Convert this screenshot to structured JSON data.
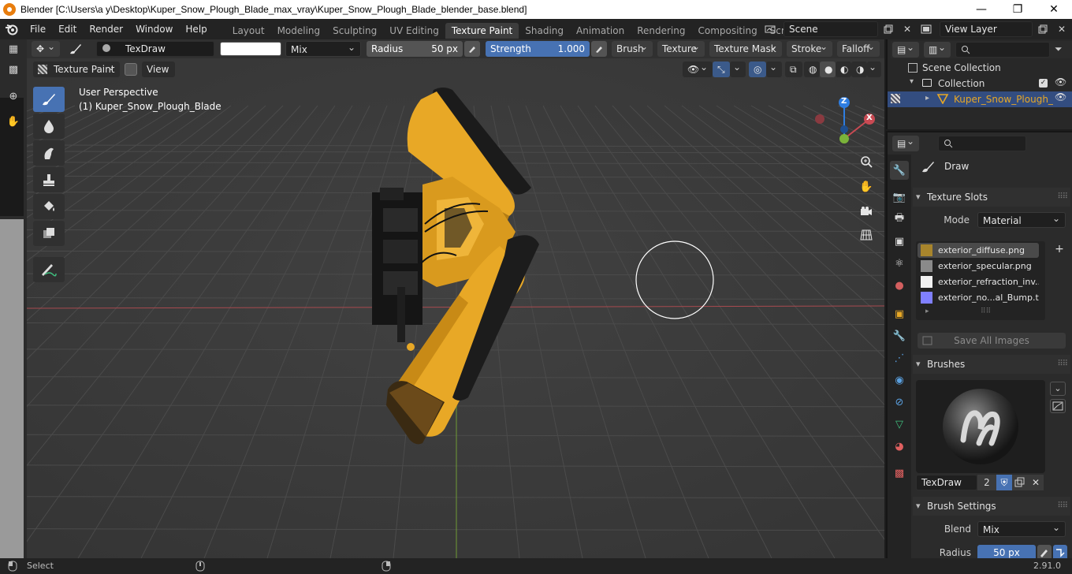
{
  "window": {
    "title": "Blender [C:\\Users\\a y\\Desktop\\Kuper_Snow_Plough_Blade_max_vray\\Kuper_Snow_Plough_Blade_blender_base.blend]",
    "minimize_glyph": "—",
    "maximize_glyph": "❐",
    "close_glyph": "✕"
  },
  "menu": {
    "items": [
      "File",
      "Edit",
      "Render",
      "Window",
      "Help"
    ]
  },
  "workspaces": {
    "tabs": [
      "Layout",
      "Modeling",
      "Sculpting",
      "UV Editing",
      "Texture Paint",
      "Shading",
      "Animation",
      "Rendering",
      "Compositing",
      "Scripting"
    ],
    "active": "Texture Paint",
    "add_glyph": "+"
  },
  "scene": {
    "name": "Scene"
  },
  "view_layer": {
    "name": "View Layer"
  },
  "tool_header": {
    "brush_name": "TexDraw",
    "blend_mode": "Mix",
    "radius_label": "Radius",
    "radius_value": "50 px",
    "strength_label": "Strength",
    "strength_value": "1.000",
    "strength_fraction": 1.0,
    "brush_menu": "Brush",
    "texture_menu": "Texture",
    "texture_mask_menu": "Texture Mask",
    "stroke_menu": "Stroke",
    "falloff_menu": "Falloff",
    "color_hex": "#ffffff"
  },
  "sub_header": {
    "mode": "Texture Paint",
    "view_menu": "View"
  },
  "viewport": {
    "perspective": "User Perspective",
    "object_label": "(1) Kuper_Snow_Plough_Blade",
    "gizmo": {
      "z": "Z",
      "x": "X"
    }
  },
  "outliner": {
    "scene_collection": "Scene Collection",
    "collection": "Collection",
    "object": "Kuper_Snow_Plough_"
  },
  "properties": {
    "active_tool": "Draw",
    "texture_slots": {
      "title": "Texture Slots",
      "mode_label": "Mode",
      "mode_value": "Material",
      "slots": [
        {
          "name": "exterior_diffuse.png",
          "active": true,
          "swatch": "#a8852c"
        },
        {
          "name": "exterior_specular.png",
          "active": false,
          "swatch": "#8a8a8a"
        },
        {
          "name": "exterior_refraction_inv...",
          "active": false,
          "swatch": "#f2f2f2"
        },
        {
          "name": "exterior_no...al_Bump.tga",
          "active": false,
          "swatch": "#8080ff"
        }
      ],
      "add_glyph": "+",
      "save_all": "Save All Images"
    },
    "brushes": {
      "title": "Brushes",
      "name": "TexDraw",
      "users": "2"
    },
    "brush_settings": {
      "title": "Brush Settings",
      "blend_label": "Blend",
      "blend_value": "Mix",
      "radius_label": "Radius",
      "radius_value": "50 px"
    }
  },
  "status": {
    "select": "Select",
    "version": "2.91.0"
  },
  "colors": {
    "accent": "#4772b3",
    "axis_x": "#c94a53",
    "axis_y": "#7bb33a",
    "axis_z": "#2e7de0",
    "plough_yellow": "#e8a826",
    "active_tab": "#3d3d3d"
  }
}
